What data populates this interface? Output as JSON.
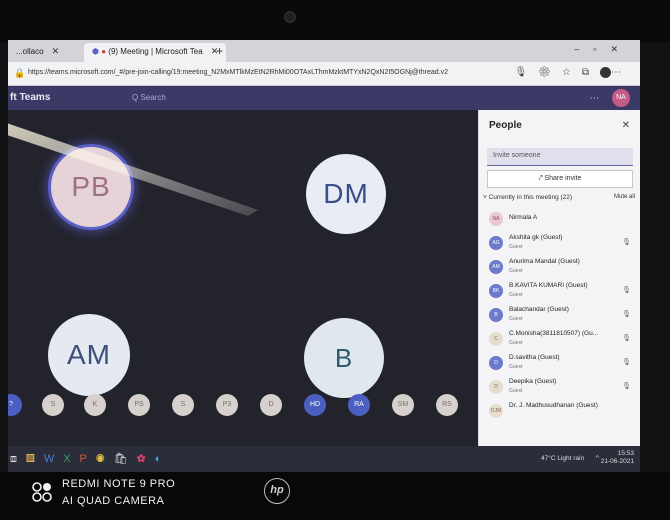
{
  "browser": {
    "tabs": [
      {
        "label": "...ollaco"
      },
      {
        "label": "(9) Meeting | Microsoft Tea"
      }
    ],
    "url": "https://teams.microsoft.com/_#/pre-join-calling/19:meeting_N2MxMTlkMzEtN2RhMi00OTAxLThmMzktMTYxN2QxN2I5OGNj@thread.v2"
  },
  "teams": {
    "app_name": "ft Teams",
    "search_placeholder": "Q Search",
    "my_initials": "NA"
  },
  "stage": {
    "tiles": [
      {
        "initials": "PB",
        "speaking": true
      },
      {
        "initials": "DM"
      },
      {
        "initials": "AM"
      },
      {
        "initials": "B"
      }
    ],
    "mini_avatars": [
      "?",
      "S",
      "K",
      "PS",
      "S",
      "P3",
      "D",
      "HD",
      "RA",
      "SM",
      "RS"
    ]
  },
  "people_panel": {
    "title": "People",
    "invite_placeholder": "Invite someone",
    "share_label": "Share invite",
    "section_label": "Currently in this meeting (22)",
    "mute_all": "Mute all",
    "people": [
      {
        "initials": "NA",
        "name": "Nirmala A",
        "role": "",
        "style": "pink"
      },
      {
        "initials": "AG",
        "name": "Akshita gk (Guest)",
        "role": "Guest",
        "style": "blue"
      },
      {
        "initials": "AM",
        "name": "Anurima Mandal (Guest)",
        "role": "Guest",
        "style": "blue"
      },
      {
        "initials": "BK",
        "name": "B.KAVITA KUMARI (Guest)",
        "role": "Guest",
        "style": "blue"
      },
      {
        "initials": "B",
        "name": "Balachandar (Guest)",
        "role": "Guest",
        "style": "blue"
      },
      {
        "initials": "C",
        "name": "C.Monisha(3811810507) (Gu...",
        "role": "Guest",
        "style": "beige"
      },
      {
        "initials": "D",
        "name": "D.savitha (Guest)",
        "role": "Guest",
        "style": "blue"
      },
      {
        "initials": "D",
        "name": "Deepika (Guest)",
        "role": "Guest",
        "style": "beige"
      },
      {
        "initials": "DJM",
        "name": "Dr. J. Madhusudhanan (Guest)",
        "role": "",
        "style": "beige"
      }
    ]
  },
  "taskbar": {
    "weather": "47°C Light rain",
    "time": "15:53",
    "date": "21-06-2021"
  },
  "watermark": {
    "line1": "REDMI NOTE 9 PRO",
    "line2": "AI QUAD CAMERA",
    "laptop_logo": "hp"
  },
  "colors": {
    "teams_purple": "#3b3a66",
    "accent": "#5b5fc7"
  }
}
